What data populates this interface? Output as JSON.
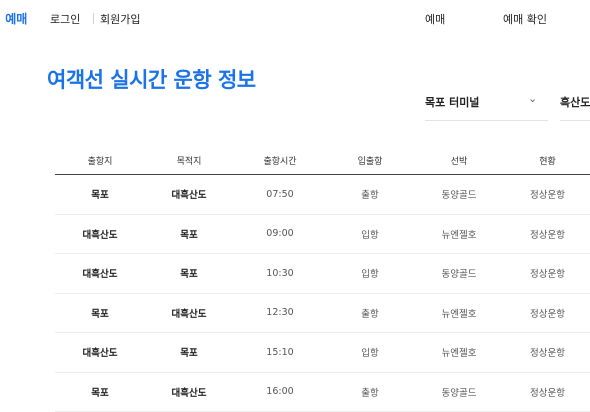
{
  "nav": {
    "brand": "선 예매",
    "login": "로그인",
    "signup": "회원가입",
    "reserve": "예매",
    "reserve_check": "예매 확인"
  },
  "page_title": "여객선 실시간 운항 정보",
  "filters": {
    "terminal": "목포 터미널",
    "destination": "흑산도"
  },
  "icons": {
    "dropdown": "chevron-down-icon"
  },
  "colors": {
    "accent": "#1a73e8"
  },
  "table": {
    "headers": [
      "출항지",
      "목적지",
      "출항시간",
      "입출항",
      "선박",
      "현황"
    ],
    "rows": [
      [
        "목포",
        "대흑산도",
        "07:50",
        "출항",
        "동양골드",
        "정상운항"
      ],
      [
        "대흑산도",
        "목포",
        "09:00",
        "입항",
        "뉴엔젤호",
        "정상운항"
      ],
      [
        "대흑산도",
        "목포",
        "10:30",
        "입항",
        "동양골드",
        "정상운항"
      ],
      [
        "목포",
        "대흑산도",
        "12:30",
        "출항",
        "뉴엔젤호",
        "정상운항"
      ],
      [
        "대흑산도",
        "목포",
        "15:10",
        "입항",
        "뉴엔젤호",
        "정상운항"
      ],
      [
        "목포",
        "대흑산도",
        "16:00",
        "출항",
        "동양골드",
        "정상운항"
      ]
    ]
  }
}
